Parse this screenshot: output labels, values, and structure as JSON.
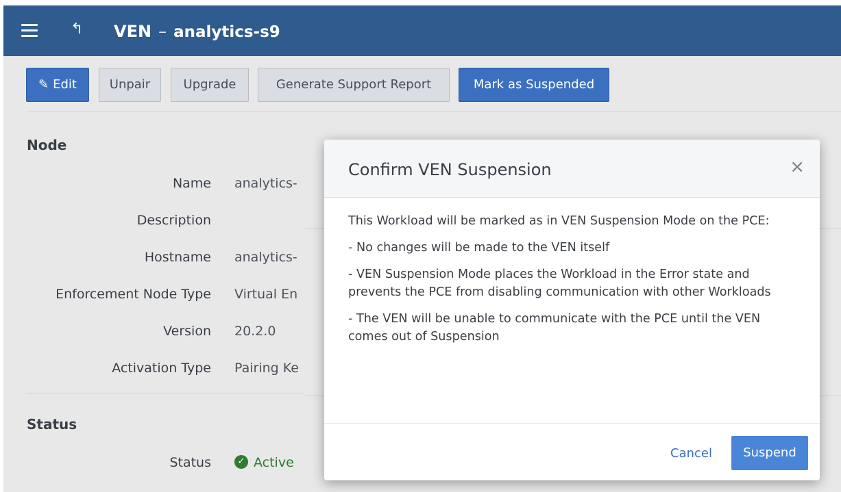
{
  "header": {
    "title_prefix": "VEN",
    "separator": "–",
    "title_name": "analytics-s9"
  },
  "toolbar": {
    "edit_label": "Edit",
    "unpair_label": "Unpair",
    "upgrade_label": "Upgrade",
    "support_report_label": "Generate Support Report",
    "suspend_label": "Mark as Suspended"
  },
  "node": {
    "section_title": "Node",
    "fields": [
      {
        "label": "Name",
        "value": "analytics-"
      },
      {
        "label": "Description",
        "value": ""
      },
      {
        "label": "Hostname",
        "value": "analytics-"
      },
      {
        "label": "Enforcement Node Type",
        "value": "Virtual En"
      },
      {
        "label": "Version",
        "value": "20.2.0"
      },
      {
        "label": "Activation Type",
        "value": "Pairing Ke"
      }
    ]
  },
  "status": {
    "section_title": "Status",
    "label": "Status",
    "value": "Active",
    "color": "#2e7d32"
  },
  "modal": {
    "title": "Confirm VEN Suspension",
    "paragraphs": [
      "This Workload will be marked as in VEN Suspension Mode on the PCE:",
      "- No changes will be made to the VEN itself",
      "- VEN Suspension Mode places the Workload in the Error state and prevents the PCE from disabling communication with other Workloads",
      "- The VEN will be unable to communicate with the PCE until the VEN comes out of Suspension"
    ],
    "cancel_label": "Cancel",
    "confirm_label": "Suspend"
  },
  "colors": {
    "header_bg": "#2f5b8e",
    "primary": "#3b6fc0",
    "confirm": "#4a86d8"
  },
  "icons": [
    "menu-icon",
    "back-arrow-icon",
    "pencil-icon",
    "close-icon",
    "check-circle-icon"
  ]
}
